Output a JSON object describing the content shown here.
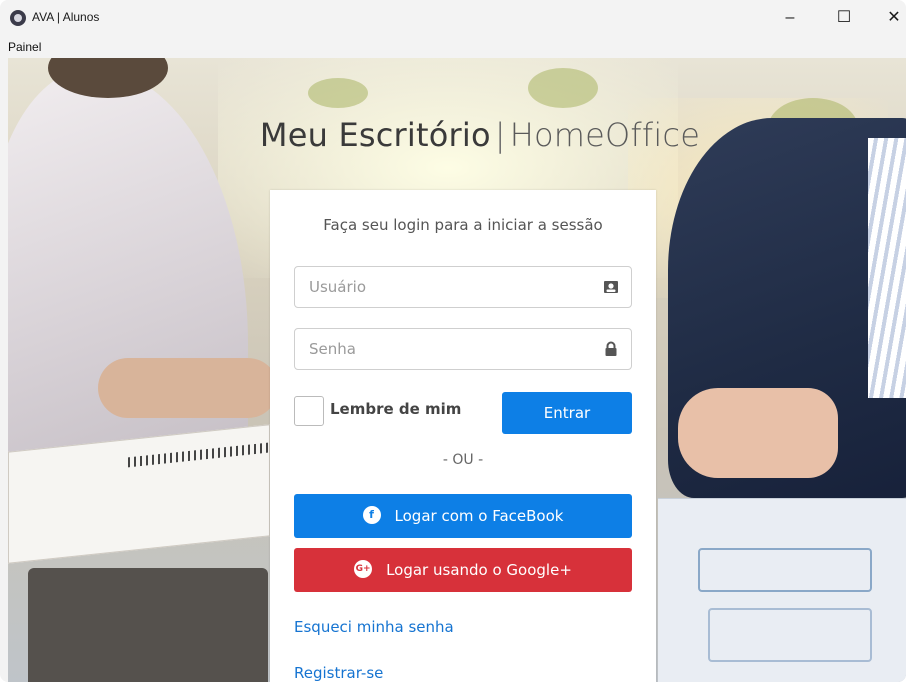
{
  "window": {
    "title": "AVA | Alunos",
    "controls": {
      "minimize": "–",
      "maximize": "☐",
      "close": "✕"
    }
  },
  "menu": {
    "items": [
      "Painel"
    ]
  },
  "hero": {
    "title_main": "Meu Escritório",
    "separator": "|",
    "title_secondary": "HomeOffice"
  },
  "login": {
    "heading": "Faça seu login para a iniciar a sessão",
    "username_placeholder": "Usuário",
    "username_icon": "user-id-icon",
    "password_placeholder": "Senha",
    "password_icon": "lock-icon",
    "remember_label": "Lembre de mim",
    "submit_label": "Entrar",
    "or_text": "- OU -",
    "facebook_label": "Logar com o FaceBook",
    "facebook_icon": "facebook-icon",
    "google_label": "Logar usando o Google+",
    "google_icon": "google-plus-icon",
    "forgot_link": "Esqueci minha senha",
    "register_link": "Registrar-se"
  },
  "colors": {
    "primary": "#0d7fe6",
    "danger": "#d7313a",
    "link": "#1674d1"
  }
}
